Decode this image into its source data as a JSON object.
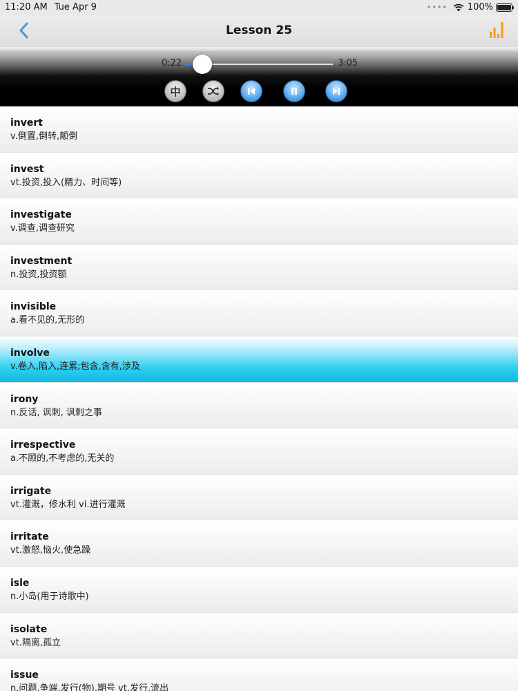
{
  "status_bar": {
    "time": "11:20 AM",
    "date": "Tue Apr 9",
    "battery_text": "100%",
    "battery_level": 1.0
  },
  "nav": {
    "title": "Lesson 25",
    "back_icon": "chevron-left-icon",
    "stats_icon": "bar-chart-icon",
    "accent_color": "#3a9be8",
    "stats_color": "#f39c12"
  },
  "player": {
    "current_time": "0:22",
    "total_time": "3:05",
    "progress": 0.119,
    "chinese_button_label": "中",
    "controls": [
      "chinese-toggle",
      "shuffle",
      "previous",
      "pause",
      "next"
    ]
  },
  "words": [
    {
      "word": "invert",
      "definition": "v.倒置,倒转,颠倒"
    },
    {
      "word": "invest",
      "definition": "vt.投资,投入(精力、时间等)"
    },
    {
      "word": "investigate",
      "definition": "v.调查,调查研究"
    },
    {
      "word": "investment",
      "definition": "n.投资,投资额"
    },
    {
      "word": "invisible",
      "definition": "a.看不见的,无形的"
    },
    {
      "word": "involve",
      "definition": "v.卷入,陷入,连累;包含,含有,涉及",
      "selected": true
    },
    {
      "word": "irony",
      "definition": "n.反话, 讽刺, 讽刺之事"
    },
    {
      "word": "irrespective",
      "definition": "a.不顾的,不考虑的,无关的"
    },
    {
      "word": "irrigate",
      "definition": "vt.灌溉，修水利 vi.进行灌溉"
    },
    {
      "word": "irritate",
      "definition": "vt.激怒,恼火,使急躁"
    },
    {
      "word": "isle",
      "definition": "n.小岛(用于诗歌中)"
    },
    {
      "word": "isolate",
      "definition": "vt.隔离,孤立"
    },
    {
      "word": "issue",
      "definition": "n.问题,争端,发行(物),期号 vt.发行,流出"
    }
  ]
}
